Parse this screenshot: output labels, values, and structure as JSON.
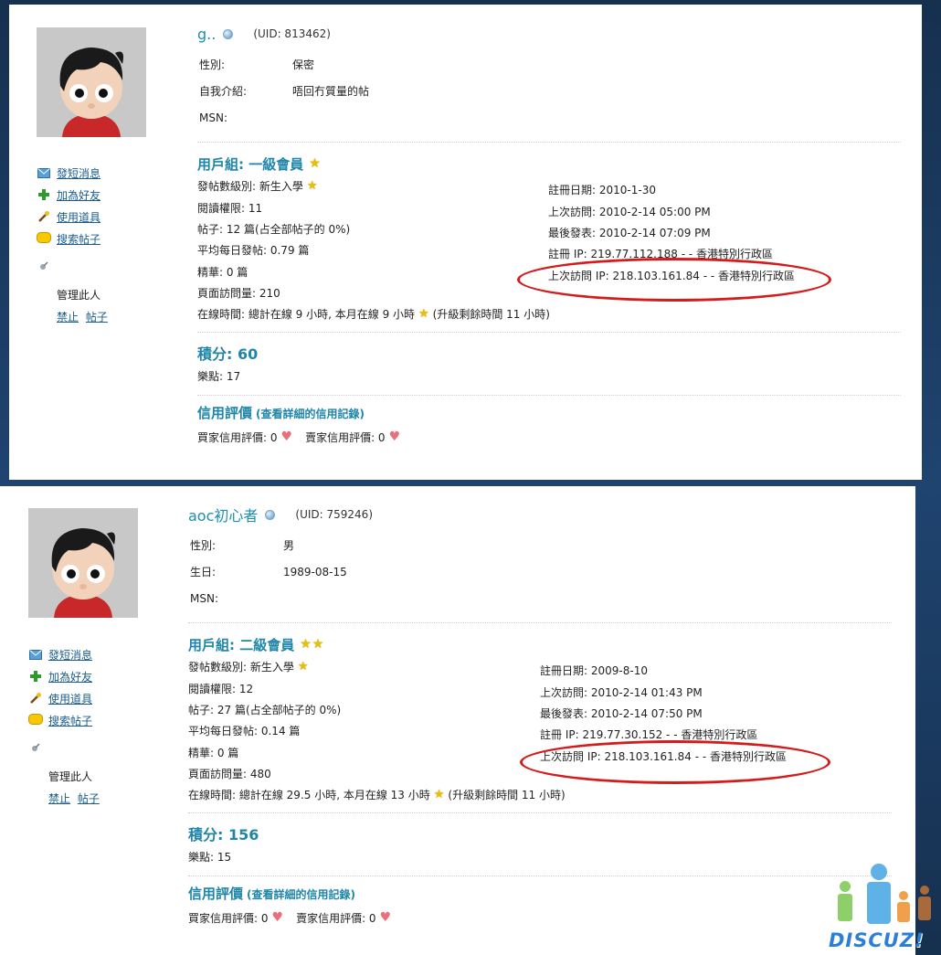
{
  "profiles": [
    {
      "username": "g..",
      "uid": "(UID: 813462)",
      "info": [
        {
          "label": "性別:",
          "value": "保密"
        },
        {
          "label": "自我介紹:",
          "value": "唔回冇質量的帖"
        },
        {
          "label": "MSN:",
          "value": ""
        }
      ],
      "side_menu": {
        "send_message": "發短消息",
        "add_friend": "加為好友",
        "use_item": "使用道具",
        "search_posts": "搜索帖子",
        "admin_label": "管理此人",
        "ban": "禁止",
        "posts": "帖子"
      },
      "group_title": "用戶組: 一級會員",
      "group_stars": 1,
      "left_stats": {
        "post_level": "發帖數級別: 新生入學",
        "read_perm": "閱讀權限: 11",
        "posts": "帖子: 12 篇(占全部帖子的 0%)",
        "avg_posts": "平均每日發帖: 0.79 篇",
        "digest": "精華: 0 篇",
        "page_views": "頁面訪問量: 210"
      },
      "right_stats": {
        "reg_date": "註冊日期: 2010-1-30",
        "last_visit": "上次訪問: 2010-2-14 05:00 PM",
        "last_post": "最後發表: 2010-2-14 07:09 PM",
        "reg_ip": "註冊 IP: 219.77.112.188 - - 香港特別行政區",
        "last_ip": "上次訪問 IP: 218.103.161.84 - - 香港特別行政區"
      },
      "online": "在線時間: 總計在線 9 小時, 本月在線 9 小時",
      "online_upgrade": "(升級剩餘時間 11 小時)",
      "points": "積分: 60",
      "fun_points": "樂點: 17",
      "credit_title": "信用評價",
      "credit_link": "(查看詳細的信用記錄)",
      "buyer_rating": "買家信用評價: 0",
      "seller_rating": "賣家信用評價: 0"
    },
    {
      "username": "aoc初心者",
      "uid": "(UID: 759246)",
      "info": [
        {
          "label": "性別:",
          "value": "男"
        },
        {
          "label": "生日:",
          "value": "1989-08-15"
        },
        {
          "label": "MSN:",
          "value": ""
        }
      ],
      "side_menu": {
        "send_message": "發短消息",
        "add_friend": "加為好友",
        "use_item": "使用道具",
        "search_posts": "搜索帖子",
        "admin_label": "管理此人",
        "ban": "禁止",
        "posts": "帖子"
      },
      "group_title": "用戶組: 二級會員",
      "group_stars": 2,
      "left_stats": {
        "post_level": "發帖數級別: 新生入學",
        "read_perm": "閱讀權限: 12",
        "posts": "帖子: 27 篇(占全部帖子的 0%)",
        "avg_posts": "平均每日發帖: 0.14 篇",
        "digest": "精華: 0 篇",
        "page_views": "頁面訪問量: 480"
      },
      "right_stats": {
        "reg_date": "註冊日期: 2009-8-10",
        "last_visit": "上次訪問: 2010-2-14 01:43 PM",
        "last_post": "最後發表: 2010-2-14 07:50 PM",
        "reg_ip": "註冊 IP: 219.77.30.152 - - 香港特別行政區",
        "last_ip": "上次訪問 IP: 218.103.161.84 - - 香港特別行政區"
      },
      "online": "在線時間: 總計在線 29.5 小時, 本月在線 13 小時",
      "online_upgrade": "(升級剩餘時間 11 小時)",
      "points": "積分: 156",
      "fun_points": "樂點: 15",
      "credit_title": "信用評價",
      "credit_link": "(查看詳細的信用記錄)",
      "buyer_rating": "買家信用評價: 0",
      "seller_rating": "賣家信用評價: 0"
    }
  ],
  "logo_text": "DISCUZ!",
  "colors": {
    "accent": "#1f86a9",
    "link": "#1a5d8c",
    "highlight": "#d41c1c",
    "background": "#1d3a5c"
  }
}
